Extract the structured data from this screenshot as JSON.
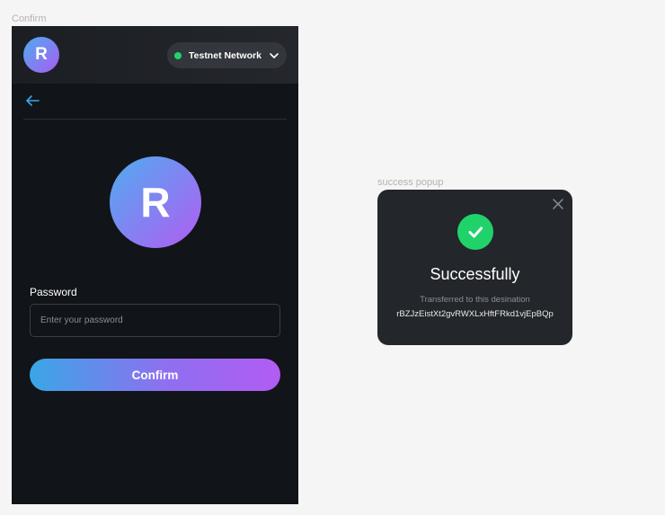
{
  "frames": {
    "confirm_label": "Confirm",
    "popup_label": "success popup"
  },
  "header": {
    "avatar_letter": "R",
    "network": {
      "label": "Testnet Network",
      "status_color": "#22d36b",
      "icon": "chevron-down-icon"
    }
  },
  "nav": {
    "back_icon": "arrow-left-icon"
  },
  "account": {
    "avatar_letter": "R"
  },
  "form": {
    "password_label": "Password",
    "password_placeholder": "Enter your password",
    "confirm_label": "Confirm"
  },
  "popup": {
    "title": "Successfully",
    "subtitle": "Transferred to this desination",
    "address": "rBZJzEistXt2gvRWXLxHftFRkd1vjEpBQp",
    "success_color": "#1fd36a",
    "close_icon": "close-icon",
    "status_icon": "check-icon"
  },
  "colors": {
    "accent_gradient_start": "#3aa6e6",
    "accent_gradient_end": "#b25cf3",
    "background_dark": "#111418"
  }
}
